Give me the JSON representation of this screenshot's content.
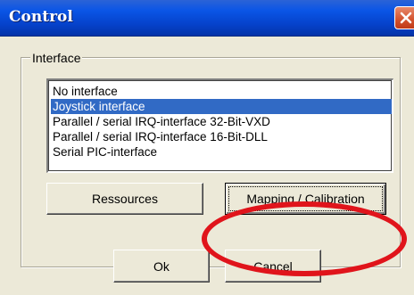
{
  "window": {
    "title": "Control",
    "close_icon": "close-icon",
    "close_color": "#d2512d"
  },
  "interface_group": {
    "label": "Interface",
    "items": [
      {
        "label": "No interface",
        "selected": false
      },
      {
        "label": "Joystick interface",
        "selected": true
      },
      {
        "label": "Parallel / serial IRQ-interface 32-Bit-VXD",
        "selected": false
      },
      {
        "label": "Parallel / serial IRQ-interface 16-Bit-DLL",
        "selected": false
      },
      {
        "label": "Serial PIC-interface",
        "selected": false
      }
    ],
    "selection_color": "#316ac5"
  },
  "buttons": {
    "resources": "Ressources",
    "mapping": "Mapping / Calibration",
    "ok": "Ok",
    "cancel": "Cancel"
  },
  "annotation": {
    "ring_color": "#e0141b"
  }
}
